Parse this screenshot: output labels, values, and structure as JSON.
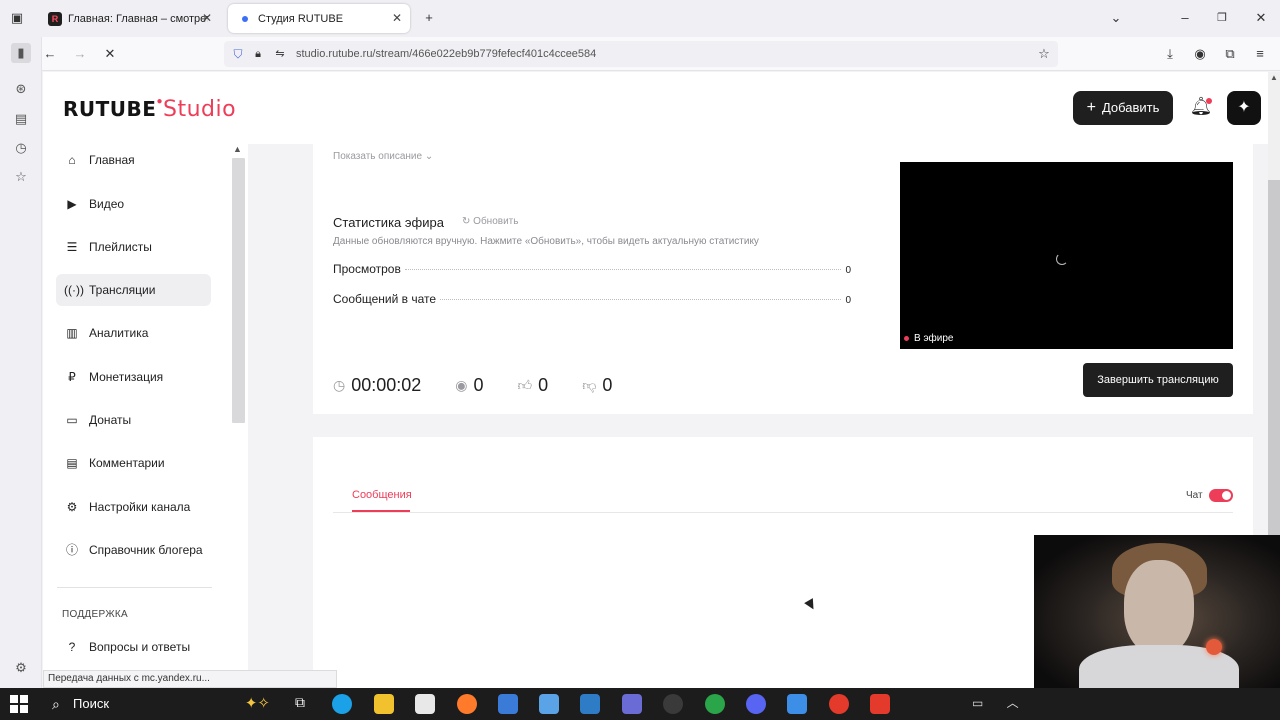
{
  "browser": {
    "tabs": [
      {
        "title": "Главная: Главная – смотреть с"
      },
      {
        "title": "Студия RUTUBE"
      }
    ],
    "url": "studio.rutube.ru/stream/466e022eb9b779fefecf401c4ccee584",
    "status_url": "Передача данных с mc.yandex.ru..."
  },
  "header": {
    "logo_brand": "RUTUBE",
    "logo_studio": "Studio",
    "add_label": "Добавить"
  },
  "sidebar": {
    "items": [
      {
        "label": "Главная",
        "icon": "home-icon"
      },
      {
        "label": "Видео",
        "icon": "video-icon"
      },
      {
        "label": "Плейлисты",
        "icon": "playlist-icon"
      },
      {
        "label": "Трансляции",
        "icon": "broadcast-icon"
      },
      {
        "label": "Аналитика",
        "icon": "analytics-icon"
      },
      {
        "label": "Монетизация",
        "icon": "ruble-icon"
      },
      {
        "label": "Донаты",
        "icon": "wallet-icon"
      },
      {
        "label": "Комментарии",
        "icon": "comment-icon"
      },
      {
        "label": "Настройки канала",
        "icon": "gear-icon"
      },
      {
        "label": "Справочник блогера",
        "icon": "info-icon"
      }
    ],
    "support_heading": "ПОДДЕРЖКА",
    "support_items": [
      {
        "label": "Вопросы и ответы",
        "icon": "help-icon"
      }
    ]
  },
  "stream": {
    "show_description": "Показать описание",
    "stats_title": "Статистика эфира",
    "refresh_label": "Обновить",
    "stats_note": "Данные обновляются вручную. Нажмите «Обновить», чтобы видеть актуальную статистику",
    "stats": [
      {
        "label": "Просмотров",
        "value": "0"
      },
      {
        "label": "Сообщений в чате",
        "value": "0"
      }
    ],
    "live_badge": "В эфире",
    "duration": "00:00:02",
    "viewers": "0",
    "likes": "0",
    "dislikes": "0",
    "end_label": "Завершить трансляцию"
  },
  "chat": {
    "tab_messages": "Сообщения",
    "chat_label": "Чат",
    "chat_enabled": true
  },
  "taskbar": {
    "search_label": "Поиск"
  },
  "colors": {
    "accent": "#ed3d58",
    "dark_button": "#1f1f1f"
  }
}
